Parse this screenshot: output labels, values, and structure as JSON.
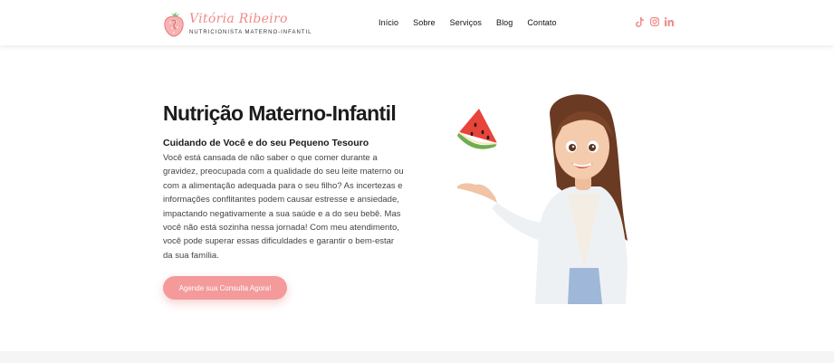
{
  "brand": {
    "name": "Vitória Ribeiro",
    "tagline": "NUTRICIONISTA MATERNO-INFANTIL",
    "icon": "strawberry-logo"
  },
  "nav": {
    "items": [
      {
        "label": "Início"
      },
      {
        "label": "Sobre"
      },
      {
        "label": "Serviços"
      },
      {
        "label": "Blog"
      },
      {
        "label": "Contato"
      }
    ]
  },
  "social": {
    "icons": [
      "tiktok-icon",
      "instagram-icon",
      "linkedin-icon"
    ],
    "color": "#f08a8a"
  },
  "hero": {
    "title": "Nutrição Materno-Infantil",
    "subtitle": "Cuidando de Você e do seu Pequeno Tesouro",
    "body": "Você está cansada de não saber o que comer durante a gravidez, preocupada com a qualidade do seu leite materno ou com a alimentação adequada para o seu filho? As incertezas e informações conflitantes podem causar estresse e ansiedade, impactando negativamente a sua saúde e a do seu bebê. Mas você não está sozinha nessa jornada! Com meu atendimento, você pode superar essas dificuldades e garantir o bem-estar da sua família.",
    "cta_label": "Agende sua Consulta Agora!"
  },
  "colors": {
    "accent": "#f49a9a",
    "text": "#1c1c1c",
    "body_text": "#444444"
  }
}
